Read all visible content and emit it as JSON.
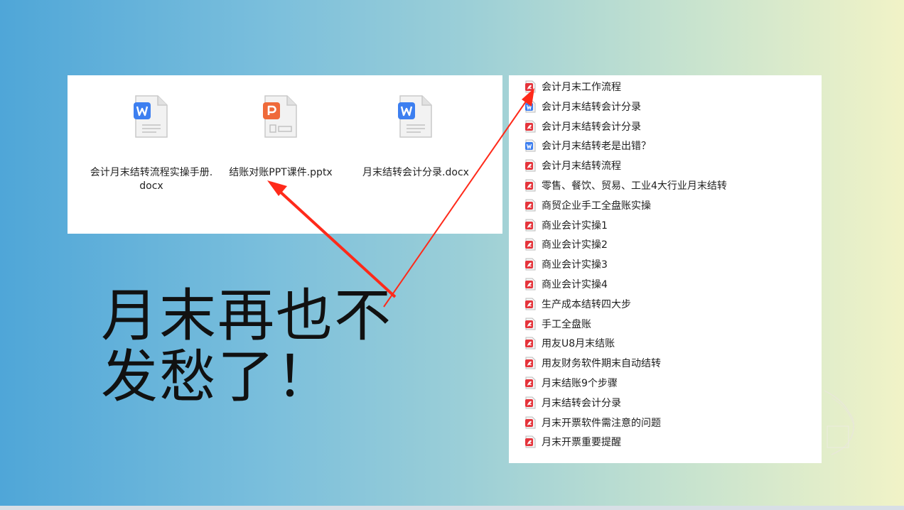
{
  "files": [
    {
      "name": "会计月末结转流程实操手册.docx",
      "icon": "word-doc-icon",
      "type": "word"
    },
    {
      "name": "结账对账PPT课件.pptx",
      "icon": "ppt-doc-icon",
      "type": "ppt"
    },
    {
      "name": "月末结转会计分录.docx",
      "icon": "word-doc-icon",
      "type": "word"
    }
  ],
  "list": [
    {
      "name": "会计月末工作流程",
      "type": "pdf"
    },
    {
      "name": "会计月末结转会计分录",
      "type": "word"
    },
    {
      "name": "会计月末结转会计分录",
      "type": "pdf"
    },
    {
      "name": "会计月末结转老是出错？",
      "type": "word"
    },
    {
      "name": "会计月末结转流程",
      "type": "pdf"
    },
    {
      "name": "零售、餐饮、贸易、工业4大行业月末结转",
      "type": "pdf"
    },
    {
      "name": "商贸企业手工全盘账实操",
      "type": "pdf"
    },
    {
      "name": "商业会计实操1",
      "type": "pdf"
    },
    {
      "name": "商业会计实操2",
      "type": "pdf"
    },
    {
      "name": "商业会计实操3",
      "type": "pdf"
    },
    {
      "name": "商业会计实操4",
      "type": "pdf"
    },
    {
      "name": "生产成本结转四大步",
      "type": "pdf"
    },
    {
      "name": "手工全盘账",
      "type": "pdf"
    },
    {
      "name": "用友U8月末结账",
      "type": "pdf"
    },
    {
      "name": "用友财务软件期末自动结转",
      "type": "pdf"
    },
    {
      "name": "月末结账9个步骤",
      "type": "pdf"
    },
    {
      "name": "月末结转会计分录",
      "type": "pdf"
    },
    {
      "name": "月末开票软件需注意的问题",
      "type": "pdf"
    },
    {
      "name": "月末开票重要提醒",
      "type": "pdf"
    }
  ],
  "slogan": {
    "line1": "月末再也不",
    "line2": "发愁了！"
  },
  "colors": {
    "word": "#3d7ff0",
    "ppt": "#ef6a3a",
    "pdf": "#e5343b",
    "arrow": "#ff2a1a"
  }
}
